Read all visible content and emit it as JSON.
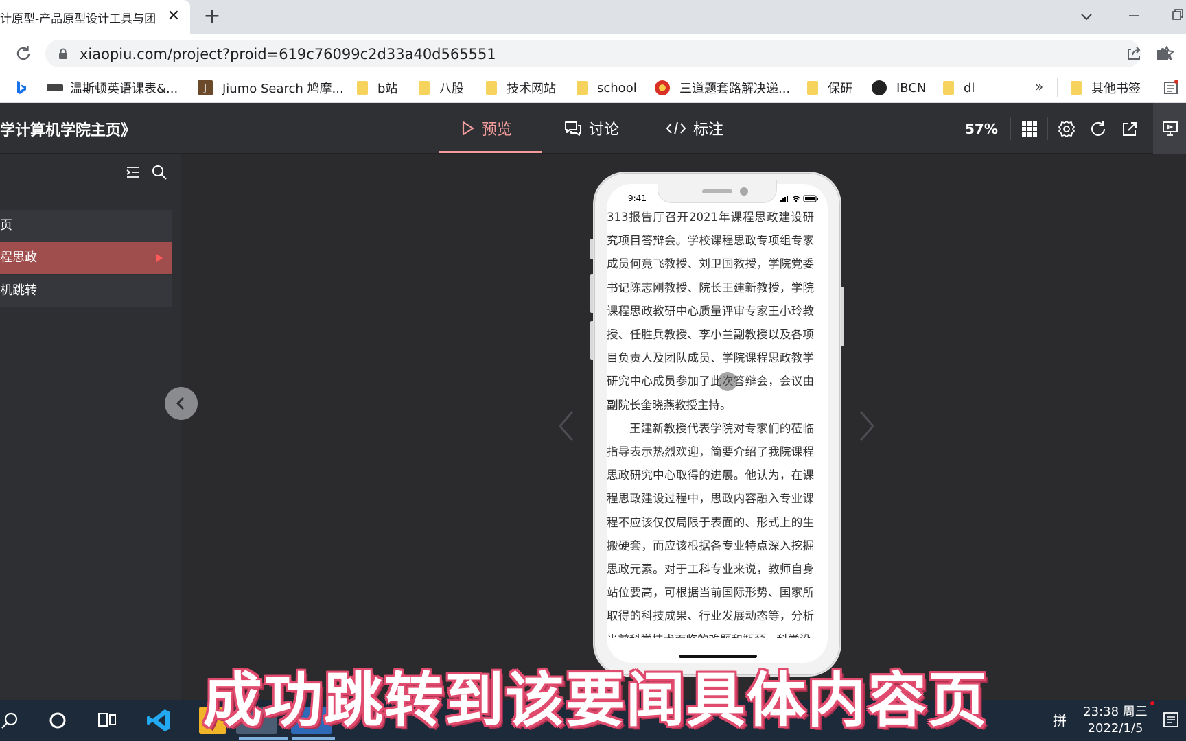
{
  "browser": {
    "tab_title": "计原型-产品原型设计工具与团",
    "tab_close": "✕",
    "new_tab": "+",
    "url": "xiaopiu.com/project?proid=619c76099c2d33a40d565551",
    "bookmarks": [
      {
        "label": "温斯顿英语课表&...",
        "icon": "winston-logo-icon"
      },
      {
        "label": "Jiumo Search 鸠摩...",
        "icon": "jiumo-icon"
      },
      {
        "label": "b站",
        "icon": "folder-icon"
      },
      {
        "label": "八股",
        "icon": "folder-icon"
      },
      {
        "label": "技术网站",
        "icon": "folder-icon"
      },
      {
        "label": "school",
        "icon": "folder-icon"
      },
      {
        "label": "三道题套路解决递...",
        "icon": "flower-icon"
      },
      {
        "label": "保研",
        "icon": "folder-icon"
      },
      {
        "label": "IBCN",
        "icon": "github-icon"
      },
      {
        "label": "dl",
        "icon": "folder-icon"
      }
    ],
    "bookmarks_more": "»",
    "other_bookmarks": "其他书签"
  },
  "app": {
    "project_title": "学计算机学院主页》",
    "tabs": {
      "preview": "预览",
      "discuss": "讨论",
      "annotate": "标注"
    },
    "zoom": "57%",
    "accent_color": "#f39c9c"
  },
  "sidebar": {
    "pages": [
      {
        "label": "页",
        "active": false
      },
      {
        "label": "程思政",
        "active": true
      },
      {
        "label": "机跳转",
        "active": false
      }
    ]
  },
  "phone": {
    "status_time": "9:41",
    "paragraphs": [
      "313报告厅召开2021年课程思政建设研究项目答辩会。学校课程思政专项组专家成员何竟飞教授、刘卫国教授，学院党委书记陈志刚教授、院长王建新教授，学院课程思政教研中心质量评审专家王小玲教授、任胜兵教授、李小兰副教授以及各项目负责人及团队成员、学院课程思政教学研究中心成员参加了此次答辩会，会议由副院长奎晓燕教授主持。",
      "王建新教授代表学院对专家们的莅临指导表示热烈欢迎，简要介绍了我院课程思政研究中心取得的进展。他认为，在课程思政建设过程中，思政内容融入专业课程不应该仅仅局限于表面的、形式上的生搬硬套，而应该根据各专业特点深入挖掘思政元素。对于工科专业来说，教师自身站位要高，可根据当前国际形势、国家所取得的科技成果、行业发展动态等，分析当前科学技术面临的难题和瓶颈，科学设"
    ]
  },
  "taskbar": {
    "time": "23:38 周三",
    "date": "2022/1/5",
    "ime": "拼"
  },
  "caption": "成功跳转到该要闻具体内容页"
}
